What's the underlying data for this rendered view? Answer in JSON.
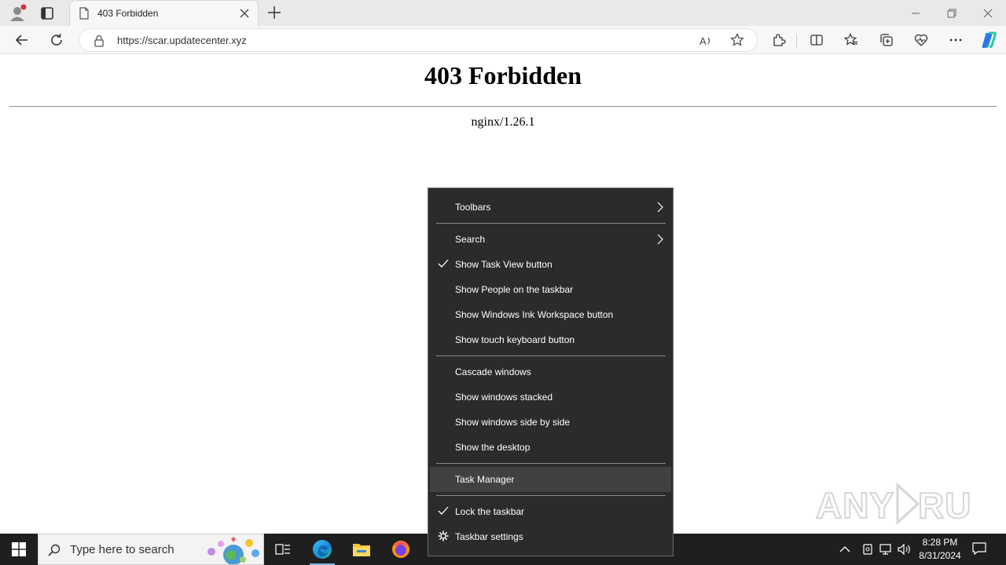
{
  "browser": {
    "tab_title": "403 Forbidden",
    "url": "https://scar.updatecenter.xyz"
  },
  "page": {
    "heading": "403 Forbidden",
    "server": "nginx/1.26.1"
  },
  "context_menu": {
    "items": [
      {
        "label": "Toolbars",
        "submenu": true
      },
      {
        "label": "Search",
        "submenu": true
      },
      {
        "label": "Show Task View button",
        "checked": true
      },
      {
        "label": "Show People on the taskbar"
      },
      {
        "label": "Show Windows Ink Workspace button"
      },
      {
        "label": "Show touch keyboard button"
      },
      {
        "label": "Cascade windows"
      },
      {
        "label": "Show windows stacked"
      },
      {
        "label": "Show windows side by side"
      },
      {
        "label": "Show the desktop"
      },
      {
        "label": "Task Manager",
        "highlighted": true
      },
      {
        "label": "Lock the taskbar",
        "checked": true
      },
      {
        "label": "Taskbar settings",
        "icon": "gear-icon"
      }
    ]
  },
  "taskbar": {
    "search_placeholder": "Type here to search",
    "time": "8:28 PM",
    "date": "8/31/2024"
  },
  "watermark": "ANY RUN",
  "colors": {
    "menu_bg": "#2b2b2b",
    "menu_highlight": "#414141",
    "taskbar_bg": "#1f1f1f",
    "accent": "#0067c0"
  }
}
